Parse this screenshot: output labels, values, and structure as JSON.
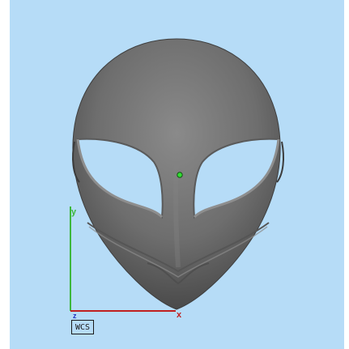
{
  "viewport": {
    "background_color": "#b6dcf7",
    "model_name": "alien-mask",
    "model_color": "#6e6e6e",
    "model_highlight_color": "#8a8a8a",
    "model_shadow_color": "#4a4a4a",
    "pivot_marker_color": "#33dd33"
  },
  "axes": {
    "x_label": "x",
    "y_label": "y",
    "z_label": "z",
    "x_color": "#c02020",
    "y_color": "#3db83d",
    "z_color": "#2030c0"
  },
  "wcs": {
    "label": "WCS"
  }
}
